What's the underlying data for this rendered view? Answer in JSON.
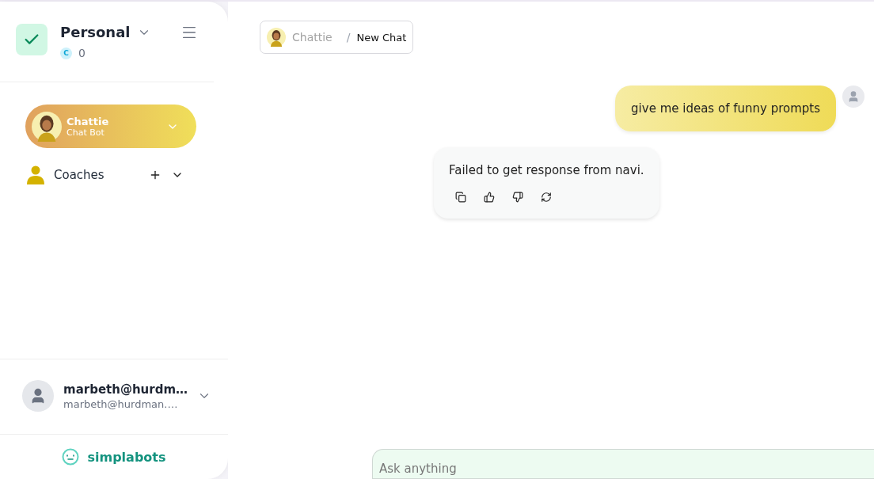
{
  "workspace": {
    "name": "Personal",
    "credit_symbol": "C",
    "credits": "0"
  },
  "bot": {
    "name": "Chattie",
    "subtitle": "Chat Bot",
    "selected": true
  },
  "coaches": {
    "label": "Coaches",
    "expanded": false
  },
  "user": {
    "name": "marbeth@hurdm…",
    "email": "marbeth@hurdman.…"
  },
  "brand": "simplabots",
  "breadcrumb": {
    "bot": "Chattie",
    "separator": "/",
    "page": "New Chat"
  },
  "messages": [
    {
      "kind": "user",
      "text": "give me ideas of funny prompts"
    },
    {
      "kind": "bot",
      "text": "Failed to get response from navi."
    }
  ],
  "composer": {
    "placeholder": "Ask anything"
  }
}
